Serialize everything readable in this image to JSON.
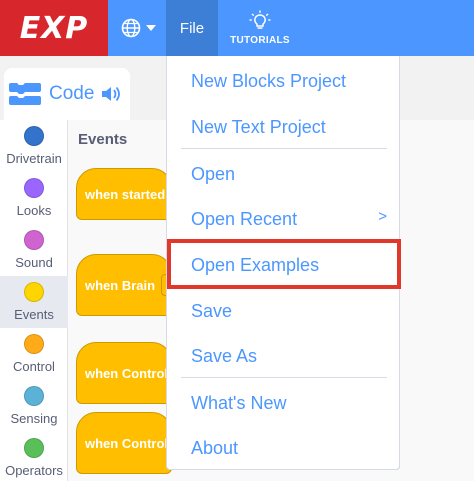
{
  "topbar": {
    "logo_text": "EXP",
    "file_label": "File",
    "tutorials_label": "TUTORIALS"
  },
  "code_tab": {
    "label": "Code"
  },
  "categories": [
    {
      "name": "Drivetrain",
      "color": "#3373cc"
    },
    {
      "name": "Looks",
      "color": "#9966ff"
    },
    {
      "name": "Sound",
      "color": "#cf63cf"
    },
    {
      "name": "Events",
      "color": "#ffd500"
    },
    {
      "name": "Control",
      "color": "#ffab19"
    },
    {
      "name": "Sensing",
      "color": "#5cb1d6"
    },
    {
      "name": "Operators",
      "color": "#59c059"
    }
  ],
  "palette": {
    "section_title": "Events",
    "blocks": [
      "when started",
      "when Brain",
      "when Control",
      "when Control"
    ]
  },
  "file_menu": {
    "items": [
      "New Blocks Project",
      "New Text Project",
      "Open",
      "Open Recent",
      "Open Examples",
      "Save",
      "Save As",
      "What's New",
      "About"
    ],
    "submenu_indicator": ">"
  },
  "colors": {
    "brand_blue": "#4c97ff",
    "logo_red": "#d8262d",
    "highlight_red": "#e0392b",
    "event_yellow": "#ffbf00"
  }
}
